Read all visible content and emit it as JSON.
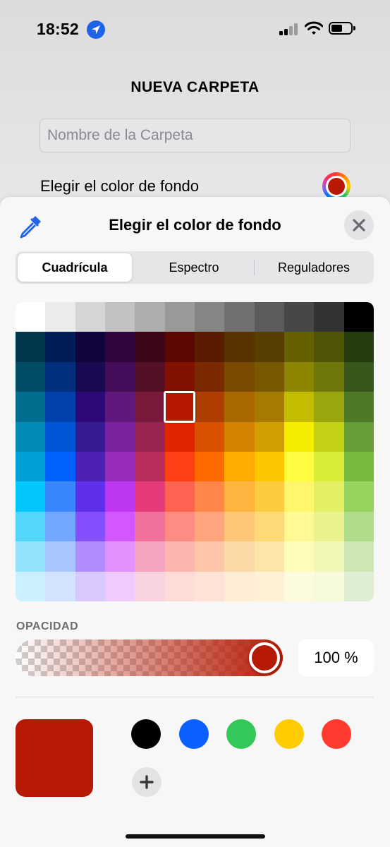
{
  "status_bar": {
    "time": "18:52"
  },
  "header": {
    "title": "NUEVA CARPETA",
    "folder_name_placeholder": "Nombre de la Carpeta",
    "background_color_label": "Elegir el color de fondo"
  },
  "picker": {
    "title": "Elegir el color de fondo",
    "tabs": [
      {
        "label": "Cuadrícula",
        "active": true
      },
      {
        "label": "Espectro",
        "active": false
      },
      {
        "label": "Reguladores",
        "active": false
      }
    ],
    "opacity_label": "OPACIDAD",
    "opacity_value": "100 %",
    "selected_color": "#b71a04"
  },
  "grid_colors": [
    [
      "#ffffff",
      "#ebebeb",
      "#d6d6d6",
      "#c2c2c2",
      "#adadad",
      "#999999",
      "#858585",
      "#707070",
      "#5c5c5c",
      "#474747",
      "#333333",
      "#000000"
    ],
    [
      "#00374a",
      "#011d57",
      "#11053b",
      "#2e063d",
      "#3c071b",
      "#5c0701",
      "#5a1c00",
      "#583300",
      "#563d00",
      "#666100",
      "#4f5504",
      "#263e0f"
    ],
    [
      "#004d65",
      "#012f7b",
      "#1a0a52",
      "#450d59",
      "#551029",
      "#831100",
      "#7b2900",
      "#7a4a00",
      "#785800",
      "#8d8602",
      "#6f760a",
      "#38571a"
    ],
    [
      "#016e8f",
      "#0042a9",
      "#2c0977",
      "#61187c",
      "#791a3d",
      "#b51a00",
      "#ad3e00",
      "#a96800",
      "#a67b01",
      "#c4bc00",
      "#9ba50e",
      "#4e7a27"
    ],
    [
      "#008cb4",
      "#0056d6",
      "#371a94",
      "#7a219e",
      "#99244f",
      "#e22400",
      "#da5100",
      "#d38301",
      "#d19d01",
      "#f5ec00",
      "#c3d117",
      "#669d34"
    ],
    [
      "#00a1d8",
      "#0061fd",
      "#4d22b2",
      "#982abc",
      "#b92d5d",
      "#ff4015",
      "#ff6a00",
      "#ffab01",
      "#fdc700",
      "#fefb41",
      "#d9ec37",
      "#76bb40"
    ],
    [
      "#01c7fc",
      "#3a87fd",
      "#5e30eb",
      "#be38f3",
      "#e63b7a",
      "#fe6250",
      "#fe8648",
      "#feb43f",
      "#fecb3e",
      "#fff76b",
      "#e4ef65",
      "#96d35f"
    ],
    [
      "#52d6fc",
      "#74a7ff",
      "#864ffd",
      "#d357fe",
      "#ee719e",
      "#ff8c82",
      "#fea57d",
      "#fec777",
      "#fed977",
      "#fff994",
      "#eaf28f",
      "#b1dd8b"
    ],
    [
      "#93e3fc",
      "#a7c6ff",
      "#b18cfe",
      "#e292fe",
      "#f4a4c0",
      "#ffb5af",
      "#ffc5ab",
      "#fed9a8",
      "#fde4a8",
      "#fffbb9",
      "#f1f7b7",
      "#cde8b5"
    ],
    [
      "#cbf0ff",
      "#d3e2ff",
      "#d9c9fe",
      "#efcaff",
      "#f9d3e0",
      "#ffdbd8",
      "#ffe2d6",
      "#feecd4",
      "#fef1d5",
      "#fdfbdd",
      "#f6fadb",
      "#deeed4"
    ]
  ],
  "presets": [
    {
      "name": "black",
      "color": "#000000"
    },
    {
      "name": "blue",
      "color": "#0a60ff"
    },
    {
      "name": "green",
      "color": "#34c759"
    },
    {
      "name": "yellow",
      "color": "#ffcc00"
    },
    {
      "name": "red",
      "color": "#ff3b30"
    }
  ],
  "icons": {
    "location": "location-arrow-icon",
    "signal": "cellular-signal-icon",
    "wifi": "wifi-icon",
    "battery": "battery-icon",
    "eyedropper": "eyedropper-icon",
    "close": "close-icon",
    "add": "plus-icon"
  }
}
